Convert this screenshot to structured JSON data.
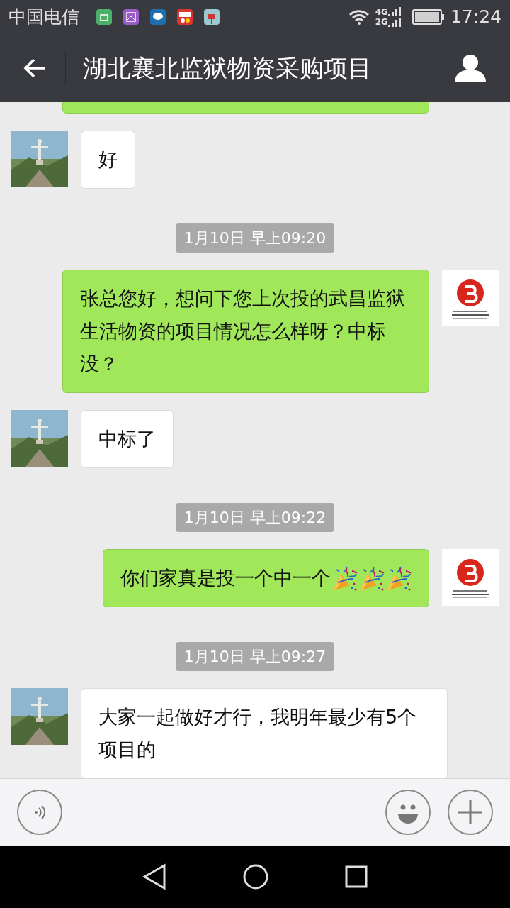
{
  "status_bar": {
    "carrier": "中国电信",
    "network_top": "4G",
    "network_bottom": "2G",
    "time": "17:24"
  },
  "title_bar": {
    "title": "湖北襄北监狱物资采购项目"
  },
  "messages": [
    {
      "kind": "sent-cut"
    },
    {
      "kind": "received",
      "text": "好"
    },
    {
      "kind": "time",
      "text": "1月10日 早上09:20"
    },
    {
      "kind": "sent",
      "text": "张总您好，想问下您上次投的武昌监狱生活物资的项目情况怎么样呀？中标没？"
    },
    {
      "kind": "received",
      "text": "中标了"
    },
    {
      "kind": "time",
      "text": "1月10日 早上09:22"
    },
    {
      "kind": "sent",
      "text": "你们家真是投一个中一个",
      "emojis": [
        {
          "kind": "party-popper"
        },
        {
          "kind": "party-popper"
        },
        {
          "kind": "party-popper"
        }
      ]
    },
    {
      "kind": "time",
      "text": "1月10日 早上09:27"
    },
    {
      "kind": "received",
      "text": "大家一起做好才行，我明年最少有5个项目的"
    }
  ]
}
